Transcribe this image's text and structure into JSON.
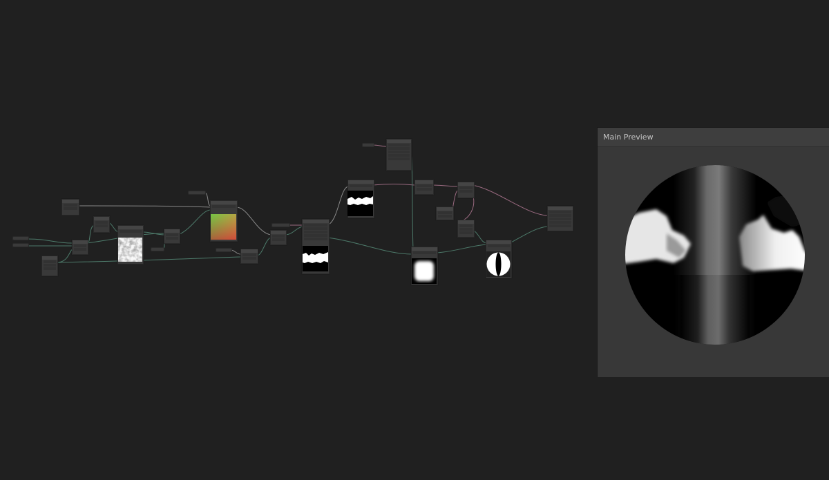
{
  "main_preview": {
    "title": "Main Preview"
  },
  "colors": {
    "background": "#202020",
    "node_body": "#393939",
    "node_header": "#454545",
    "wire_teal": "#4d7a6a",
    "wire_grey": "#7a7a7a",
    "wire_pink": "#9a6a80",
    "preview_panel": "#383838"
  },
  "icons": [
    "sphere-preview-icon"
  ]
}
